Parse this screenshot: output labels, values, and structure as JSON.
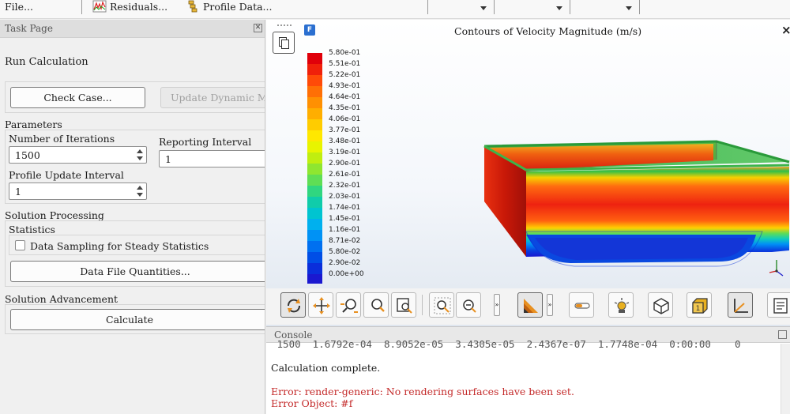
{
  "toolbar": {
    "file_label": "File...",
    "residuals_label": "Residuals...",
    "profile_data_label": "Profile Data..."
  },
  "task_page": {
    "title": "Task Page",
    "heading": "Run Calculation",
    "check_case_label": "Check Case...",
    "update_dynamic_mesh_label": "Update Dynamic Mesh...",
    "parameters_label": "Parameters",
    "number_of_iterations_label": "Number of Iterations",
    "number_of_iterations_value": "1500",
    "reporting_interval_label": "Reporting Interval",
    "reporting_interval_value": "1",
    "profile_update_interval_label": "Profile Update Interval",
    "profile_update_interval_value": "1",
    "solution_processing_label": "Solution Processing",
    "statistics_label": "Statistics",
    "data_sampling_label": "Data Sampling for Steady Statistics",
    "data_sampling_checked": false,
    "data_file_quantities_label": "Data File Quantities...",
    "solution_advancement_label": "Solution Advancement",
    "calculate_label": "Calculate"
  },
  "graphics": {
    "title": "Contours of Velocity Magnitude (m/s)",
    "logo_letter": "F",
    "colorbar_labels": [
      "5.80e-01",
      "5.51e-01",
      "5.22e-01",
      "4.93e-01",
      "4.64e-01",
      "4.35e-01",
      "4.06e-01",
      "3.77e-01",
      "3.48e-01",
      "3.19e-01",
      "2.90e-01",
      "2.61e-01",
      "2.32e-01",
      "2.03e-01",
      "1.74e-01",
      "1.45e-01",
      "1.16e-01",
      "8.71e-02",
      "5.80e-02",
      "2.90e-02",
      "0.00e+00"
    ],
    "colorbar_colors": [
      "#e0000a",
      "#f0200a",
      "#ff4a08",
      "#ff6f05",
      "#ff9002",
      "#ffae00",
      "#ffcc00",
      "#ffe800",
      "#e8f400",
      "#c0ee10",
      "#8fe630",
      "#5fde55",
      "#30d680",
      "#10ccaa",
      "#00c4d0",
      "#00b0ee",
      "#0092f5",
      "#0070f0",
      "#004ee6",
      "#0a2edb",
      "#1a18d0"
    ]
  },
  "toolbar2": {
    "more_glyph": "»"
  },
  "console": {
    "title": "Console",
    "partial_line": " 1500  1.6792e-04  8.9052e-05  3.4305e-05  2.4367e-07  1.7748e-04  0:00:00    0",
    "complete_line": "Calculation complete.",
    "error_line": "Error: render-generic: No rendering surfaces have been set.",
    "error_object_line": "Error Object: #f"
  }
}
